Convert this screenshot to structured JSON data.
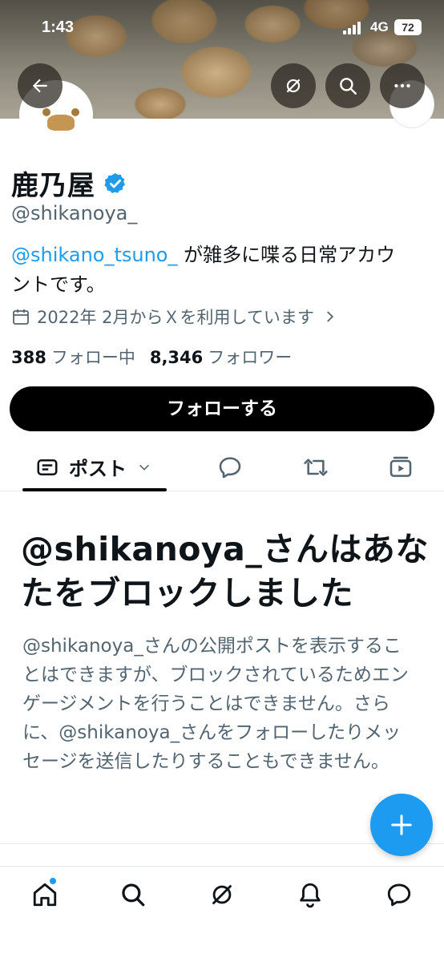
{
  "status_bar": {
    "time": "1:43",
    "network": "4G",
    "battery": "72"
  },
  "header_actions": {
    "back_icon": "arrow-left-icon",
    "grok_icon": "grok-icon",
    "search_icon": "search-icon",
    "more_icon": "more-dots-icon"
  },
  "profile": {
    "display_name": "鹿乃屋",
    "verified": true,
    "handle": "@shikanoya_",
    "bio_mention": "@shikano_tsuno_",
    "bio_text_line1": " が雑多に喋る日常アカウ",
    "bio_text_line2": "ントです。",
    "joined": "2022年 2月からＸを利用しています",
    "following_count": "388",
    "following_label": "フォロー中",
    "followers_count": "8,346",
    "followers_label": "フォロワー"
  },
  "follow_button": {
    "label": "フォローする"
  },
  "tabs": {
    "posts_label": "ポスト",
    "replies_icon": "reply-bubble-icon",
    "reposts_icon": "repost-icon",
    "media_icon": "media-play-icon"
  },
  "blocked": {
    "title": "@shikanoya_さんはあなたをブロックしました",
    "description": "@shikanoya_さんの公開ポストを表示することはできますが、ブロックされているためエンゲージメントを行うことはできません。さらに、@shikanoya_さんをフォローしたりメッセージを送信したりすることもできません。"
  },
  "fab": {
    "icon": "plus-icon"
  },
  "bottom_nav": {
    "items": [
      "home-icon",
      "search-icon",
      "grok-icon",
      "notifications-bell-icon",
      "messages-icon"
    ]
  },
  "colors": {
    "accent": "#1d9bf0",
    "text_primary": "#0f1419",
    "text_secondary": "#536471",
    "button_dark": "#000000"
  }
}
